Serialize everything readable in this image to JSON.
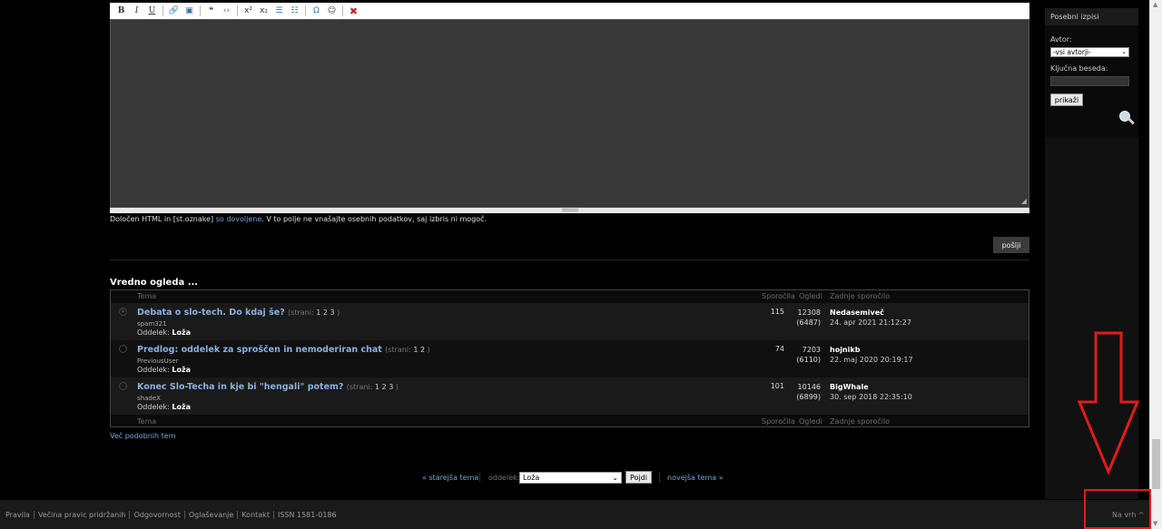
{
  "toolbar": {
    "buttons": [
      {
        "name": "bold-button",
        "glyph": "B",
        "cls": "bold"
      },
      {
        "name": "italic-button",
        "glyph": "I",
        "cls": "it"
      },
      {
        "name": "underline-button",
        "glyph": "U",
        "cls": "u"
      },
      {
        "sep": true
      },
      {
        "name": "link-icon",
        "glyph": "🔗",
        "cls": ""
      },
      {
        "name": "image-icon",
        "glyph": "▣",
        "cls": "blue"
      },
      {
        "sep": true
      },
      {
        "name": "quote-icon",
        "glyph": "❝",
        "cls": ""
      },
      {
        "name": "code-icon",
        "glyph": "‹›",
        "cls": "blue"
      },
      {
        "sep": true
      },
      {
        "name": "superscript-icon",
        "glyph": "x²",
        "cls": ""
      },
      {
        "name": "subscript-icon",
        "glyph": "x₂",
        "cls": ""
      },
      {
        "name": "bullet-list-icon",
        "glyph": "☰",
        "cls": "blue"
      },
      {
        "name": "numbered-list-icon",
        "glyph": "☷",
        "cls": "blue"
      },
      {
        "sep": true
      },
      {
        "name": "special-chars-icon",
        "glyph": "Ω",
        "cls": "blue"
      },
      {
        "name": "emoji-icon",
        "glyph": "☺",
        "cls": ""
      },
      {
        "sep": true
      },
      {
        "name": "clear-format-icon",
        "glyph": "✖",
        "cls": "red"
      }
    ]
  },
  "editor": {
    "note_prefix": "Določen HTML in [st.oznake] ",
    "note_link": "so dovoljene",
    "note_suffix": ". V to polje ne vnašajte osebnih podatkov, saj izbris ni mogoč.",
    "submit_label": "pošlji"
  },
  "related": {
    "title": "Vredno ogleda ...",
    "columns": {
      "topic": "Tema",
      "messages": "Sporočila",
      "views": "Ogledi",
      "last": "Zadnje sporočilo"
    },
    "section_label": "Oddelek:",
    "pages_label": "(strani:",
    "rows": [
      {
        "title": "Debata o slo-tech. Do kdaj še?",
        "pages": "1 2 3",
        "user": "spam321",
        "section": "Loža",
        "messages": "115",
        "views": "12308",
        "views_sub": "(6487)",
        "last_user": "Nedasemiveč",
        "last_date": "24. apr 2021 21:12:27",
        "icon": "»"
      },
      {
        "title": "Predlog: oddelek za sproščen in nemoderiran chat",
        "pages": "1 2",
        "user": "PreviousUser",
        "section": "Loža",
        "messages": "74",
        "views": "7203",
        "views_sub": "(6110)",
        "last_user": "hojnikb",
        "last_date": "22. maj 2020 20:19:17",
        "icon": ""
      },
      {
        "title": "Konec Slo-Techa in kje bi \"hengali\" potem?",
        "pages": "1 2 3",
        "user": "shadeX",
        "section": "Loža",
        "messages": "101",
        "views": "10146",
        "views_sub": "(6899)",
        "last_user": "BigWhale",
        "last_date": "30. sep 2018 22:35:10",
        "icon": ""
      }
    ],
    "more_link": "Več podobnih tem"
  },
  "nav": {
    "prev": "« starejša tema",
    "section_label": "oddelek:",
    "section_value": "Loža",
    "go_label": "Pojdi",
    "next": "novejša tema »"
  },
  "sidebar": {
    "title": "Posebni izpisi",
    "author_label": "Avtor:",
    "author_value": "-vsi avtorji-",
    "keyword_label": "Ključna beseda:",
    "show_button": "prikaži"
  },
  "footer": {
    "links": [
      "Pravila",
      "Večina pravic pridržanih",
      "Odgovornost",
      "Oglaševanje",
      "Kontakt",
      "ISSN 1581-0186"
    ],
    "to_top": "Na vrh ^"
  },
  "colors": {
    "highlight": "#e01b1b",
    "link": "#7aa6d6",
    "background": "#000000"
  }
}
